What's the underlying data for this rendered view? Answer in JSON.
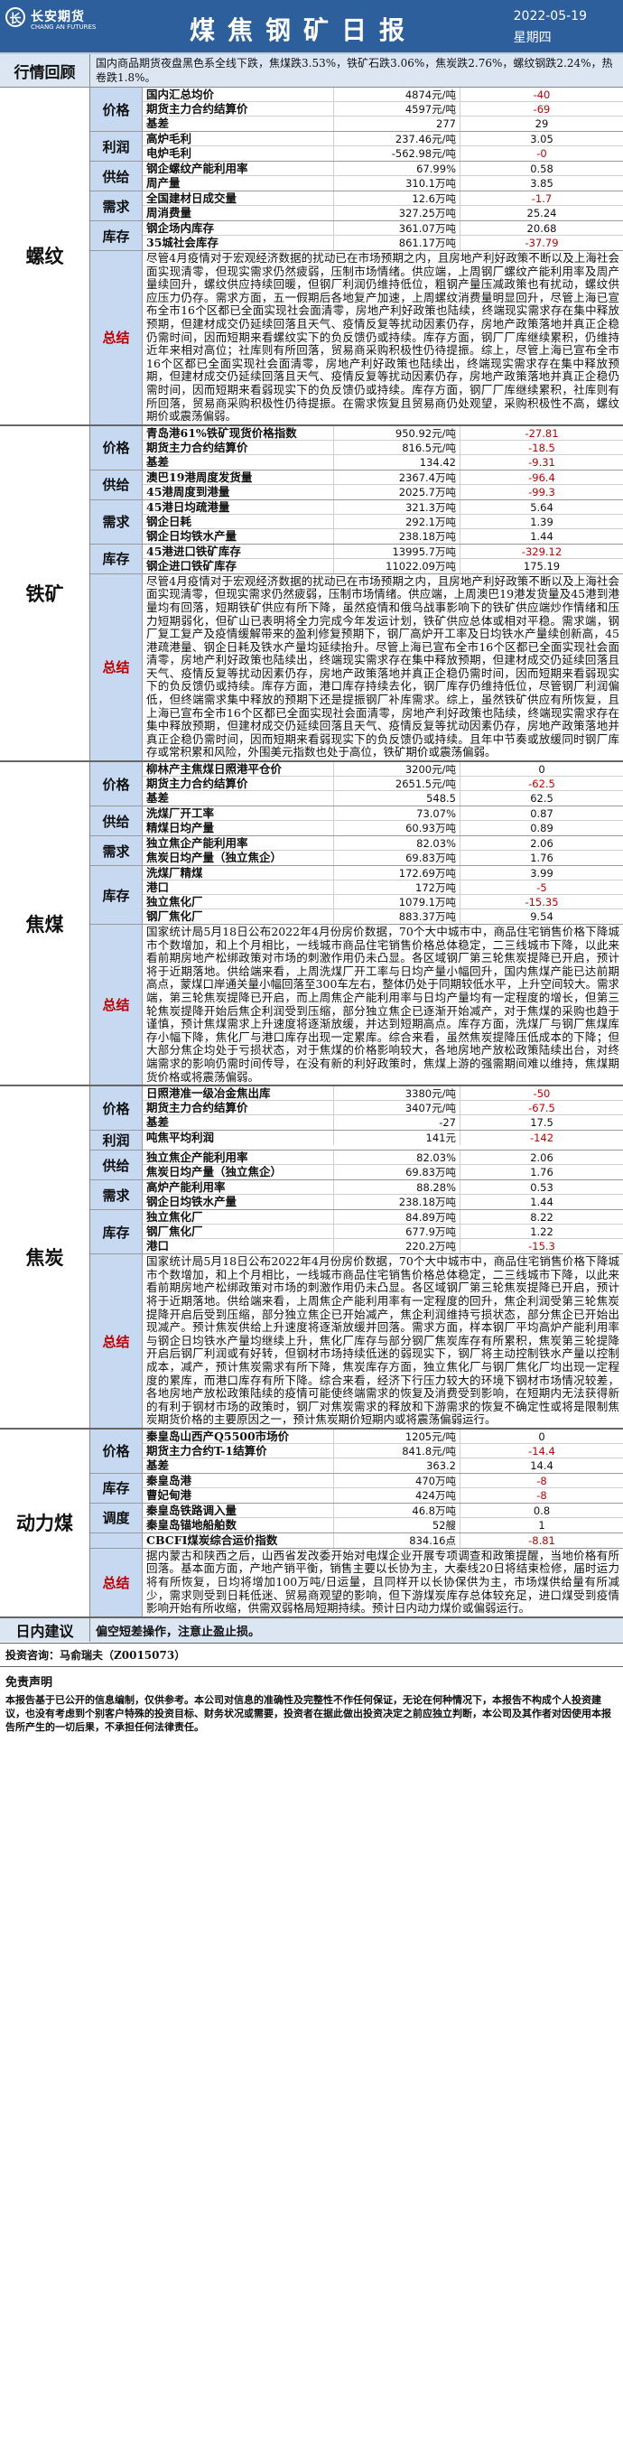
{
  "header": {
    "logo_mark": "长",
    "logo_cn": "长安期货",
    "logo_en": "CHANG AN FUTURES",
    "title": "煤焦钢矿日报",
    "date": "2022-05-19",
    "weekday": "星期四"
  },
  "review": {
    "label": "行情回顾",
    "text": "国内商品期货夜盘黑色系全线下跌，焦煤跌3.53%，铁矿石跌3.06%，焦炭跌2.76%，螺纹钢跌2.24%，热卷跌1.8%。"
  },
  "sections": [
    {
      "name": "螺纹",
      "groups": [
        {
          "cat": "价格",
          "rows": [
            [
              "国内汇总均价",
              "4874元/吨",
              "-40"
            ],
            [
              "期货主力合约结算价",
              "4597元/吨",
              "-69"
            ],
            [
              "基差",
              "277",
              "29"
            ]
          ]
        },
        {
          "cat": "利润",
          "rows": [
            [
              "高炉毛利",
              "237.46元/吨",
              "3.05"
            ],
            [
              "电炉毛利",
              "-562.98元/吨",
              "-0"
            ]
          ]
        },
        {
          "cat": "供给",
          "rows": [
            [
              "钢企螺纹产能利用率",
              "67.99%",
              "0.58"
            ],
            [
              "周产量",
              "310.1万吨",
              "3.85"
            ]
          ]
        },
        {
          "cat": "需求",
          "rows": [
            [
              "全国建材日成交量",
              "12.6万吨",
              "-1.7"
            ],
            [
              "周消费量",
              "327.25万吨",
              "25.24"
            ]
          ]
        },
        {
          "cat": "库存",
          "rows": [
            [
              "钢企场内库存",
              "361.07万吨",
              "20.68"
            ],
            [
              "35城社会库存",
              "861.17万吨",
              "-37.79"
            ]
          ]
        }
      ],
      "summary": "尽管4月疫情对于宏观经济数据的扰动已在市场预期之内，且房地产利好政策不断以及上海社会面实现清零，但现实需求仍然疲弱，压制市场情绪。供应端，上周钢厂螺纹产能利用率及周产量续回升，螺纹供应持续回暖，但钢厂利润仍维持低位，粗钢产量压减政策也有扰动，螺纹供应压力仍存。需求方面，五一假期后各地复产加速，上周螺纹消费量明显回升，尽管上海已宣布全市16个区都已全面实现社会面清零，房地产利好政策也陆续，终端现实需求存在集中释放预期，但建材成交仍延续回落且天气、疫情反复等扰动因素仍存，房地产政策落地并真正企稳仍需时间，因而短期来看螺纹实下的负反馈仍或持续。库存方面，钢厂厂库继续累积，仍维持近年来相对高位；社库则有所回落，贸易商采购积极性仍待提振。综上，尽管上海已宣布全市16个区都已全面实现社会面清零，房地产利好政策也陆续出，终端现实需求存在集中释放预期，但建材成交仍延续回落且天气、疫情反复等扰动因素仍存，房地产政策落地并真正企稳仍需时间，因而短期来看弱现实下的负反馈仍或持续。库存方面，钢厂厂库继续累积，社库则有所回落，贸易商采购积极性仍待提振。在需求恢复且贸易商仍处观望，采购积极性不高，螺纹期价或震荡偏弱。"
    },
    {
      "name": "铁矿",
      "groups": [
        {
          "cat": "价格",
          "rows": [
            [
              "青岛港61%铁矿现货价格指数",
              "950.92元/吨",
              "-27.81"
            ],
            [
              "期货主力合约结算价",
              "816.5元/吨",
              "-18.5"
            ],
            [
              "基差",
              "134.42",
              "-9.31"
            ]
          ]
        },
        {
          "cat": "供给",
          "rows": [
            [
              "澳巴19港周度发货量",
              "2367.4万吨",
              "-96.4"
            ],
            [
              "45港周度到港量",
              "2025.7万吨",
              "-99.3"
            ]
          ]
        },
        {
          "cat": "需求",
          "rows": [
            [
              "45港日均疏港量",
              "321.3万吨",
              "5.64"
            ],
            [
              "钢企日耗",
              "292.1万吨",
              "1.39"
            ],
            [
              "钢企日均铁水产量",
              "238.18万吨",
              "1.44"
            ]
          ]
        },
        {
          "cat": "库存",
          "rows": [
            [
              "45港进口铁矿库存",
              "13995.7万吨",
              "-329.12"
            ],
            [
              "钢企进口铁矿库存",
              "11022.09万吨",
              "175.19"
            ]
          ]
        }
      ],
      "summary": "尽管4月疫情对于宏观经济数据的扰动已在市场预期之内，且房地产利好政策不断以及上海社会面实现清零，但现实需求仍然疲弱，压制市场情绪。供应端，上周澳巴19港发货量及45港到港量均有回落，短期铁矿供应有所下降，虽然疫情和俄乌战事影响下的铁矿供应端炒作情绪和压力短期弱化，但矿山已表明将全力完成今年发运计划，铁矿供应总体或相对平稳。需求端，钢厂复工复产及疫情缓解带来的盈利修复预期下，钢厂高炉开工率及日均铁水产量续创新高，45港疏港量、钢企日耗及铁水产量均延续抬升。尽管上海已宣布全市16个区都已全面实现社会面清零，房地产利好政策也陆续出，终端现实需求存在集中释放预期，但建材成交仍延续回落且天气、疫情反复等扰动因素仍存，房地产政策落地并真正企稳仍需时间，因而短期来看弱现实下的负反馈仍或持续。库存方面，港口库存持续去化，钢厂库存仍维持低位，尽管钢厂利润偏低，但终端需求集中释放的预期下还是提振钢厂补库需求。综上，虽然铁矿供应有所恢复，且上海已宣布全市16个区都已全面实现社会面清零，房地产利好政策也陆续，终端现实需求存在集中释放预期，但建材成交仍延续回落且天气、疫情反复等扰动因素仍存，房地产政策落地并真正企稳仍需时间，因而短期来看弱现实下的负反馈仍或持续。且年中节奏或放缓同时钢厂库存或常积累和风险，外围美元指数也处于高位，铁矿期价或震荡偏弱。"
    },
    {
      "name": "焦煤",
      "groups": [
        {
          "cat": "价格",
          "rows": [
            [
              "柳林产主焦煤日照港平仓价",
              "3200元/吨",
              "0"
            ],
            [
              "期货主力合约结算价",
              "2651.5元/吨",
              "-62.5"
            ],
            [
              "基差",
              "548.5",
              "62.5"
            ]
          ]
        },
        {
          "cat": "供给",
          "rows": [
            [
              "洗煤厂开工率",
              "73.07%",
              "0.87"
            ],
            [
              "精煤日均产量",
              "60.93万吨",
              "0.89"
            ]
          ]
        },
        {
          "cat": "需求",
          "rows": [
            [
              "独立焦企产能利用率",
              "82.03%",
              "2.06"
            ],
            [
              "焦炭日均产量（独立焦企）",
              "69.83万吨",
              "1.76"
            ]
          ]
        },
        {
          "cat": "库存",
          "rows": [
            [
              "洗煤厂精煤",
              "172.69万吨",
              "3.99"
            ],
            [
              "港口",
              "172万吨",
              "-5"
            ],
            [
              "独立焦化厂",
              "1079.1万吨",
              "-15.35"
            ],
            [
              "钢厂焦化厂",
              "883.37万吨",
              "9.54"
            ]
          ]
        }
      ],
      "summary": "国家统计局5月18日公布2022年4月份房价数据，70个大中城市中，商品住宅销售价格下降城市个数增加，和上个月相比，一线城市商品住宅销售价格总体稳定，二三线城市下降，以此来看前期房地产松绑政策对市场的刺激作用仍未凸显。各区域钢厂第三轮焦炭提降已开启，预计将于近期落地。供给端来看，上周洗煤厂开工率与日均产量小幅回升，国内焦煤产能已达前期高点，蒙煤口岸通关量小幅回落至300车左右，整体仍处于同期较低水平，上升空间较大。需求端，第三轮焦炭提降已开启，而上周焦企产能利用率与日均产量均有一定程度的增长，但第三轮焦炭提降开始后焦企利润受到压缩，部分独立焦企已逐渐开始减产，对于焦煤的采购也趋于谨慎，预计焦煤需求上升速度将逐渐放缓，并达到短期高点。库存方面，洗煤厂与钢厂焦煤库存小幅下降，焦化厂与港口库存出现一定累库。综合来看，虽然焦炭提降压低成本的下降；但大部分焦企均处于亏损状态，对于焦煤的价格影响较大，各地房地产放松政策陆续出台，对终端需求的影响仍需时间传导，在没有新的利好政策时，焦煤上游的强需期间难以维持，焦煤期货价格或将震荡偏弱。"
    },
    {
      "name": "焦炭",
      "groups": [
        {
          "cat": "价格",
          "rows": [
            [
              "日照港准一级冶金焦出库",
              "3380元/吨",
              "-50"
            ],
            [
              "期货主力合约结算价",
              "3407元/吨",
              "-67.5"
            ],
            [
              "基差",
              "-27",
              "17.5"
            ]
          ]
        },
        {
          "cat": "利润",
          "rows": [
            [
              "吨焦平均利润",
              "141元",
              "-142"
            ]
          ]
        },
        {
          "cat": "供给",
          "rows": [
            [
              "独立焦企产能利用率",
              "82.03%",
              "2.06"
            ],
            [
              "焦炭日均产量（独立焦企）",
              "69.83万吨",
              "1.76"
            ]
          ]
        },
        {
          "cat": "需求",
          "rows": [
            [
              "高炉产能利用率",
              "88.28%",
              "0.53"
            ],
            [
              "钢企日均铁水产量",
              "238.18万吨",
              "1.44"
            ]
          ]
        },
        {
          "cat": "库存",
          "rows": [
            [
              "独立焦化厂",
              "84.89万吨",
              "8.22"
            ],
            [
              "钢厂焦化厂",
              "677.9万吨",
              "1.22"
            ],
            [
              "港口",
              "220.2万吨",
              "-15.3"
            ]
          ]
        }
      ],
      "summary": "国家统计局5月18日公布2022年4月份房价数据，70个大中城市中，商品住宅销售价格下降城市个数增加，和上个月相比，一线城市商品住宅销售价格总体稳定，二三线城市下降，以此来看前期房地产松绑政策对市场的刺激作用仍未凸显。各区域钢厂第三轮焦炭提降已开启，预计将于近期落地。供给端来看，上周焦企产能利用率有一定程度的回升，焦企利润受第三轮焦炭提降开启后受到压缩，部分独立焦企已开始减产，焦企利润维持亏损状态，部分焦企已开始出现减产。预计焦炭供给上升速度将逐渐放缓并回落。需求方面，样本钢厂平均高炉产能利用率与钢企日均铁水产量均继续上升，焦化厂库存与部分钢厂焦炭库存有所累积，焦炭第三轮提降开启后钢厂利润或有好转，但钢材市场持续低迷的弱现实下，钢厂将主动控制铁水产量以控制成本，减产，预计焦炭需求有所下降，焦炭库存方面，独立焦化厂与钢厂焦化厂均出现一定程度的累库，而港口库存有所下降。综合来看，经济下行压力较大的环境下钢材市场情况较差，各地房地产放松政策陆续的疫情可能使终端需求的恢复及消费受到影响，在短期内无法获得新的有利于钢材市场的政策时，钢厂对焦炭需求的释放和下游需求的恢复不确定性或将是限制焦炭期货价格的主要原因之一，预计焦炭期价短期内或将震荡偏弱运行。"
    },
    {
      "name": "动力煤",
      "groups": [
        {
          "cat": "价格",
          "rows": [
            [
              "秦皇岛山西产Q5500市场价",
              "1205元/吨",
              "0"
            ],
            [
              "期货主力合约T-1结算价",
              "841.8元/吨",
              "-14.4"
            ],
            [
              "基差",
              "363.2",
              "14.4"
            ]
          ]
        },
        {
          "cat": "库存",
          "rows": [
            [
              "秦皇岛港",
              "470万吨",
              "-8"
            ],
            [
              "曹妃甸港",
              "424万吨",
              "-8"
            ]
          ]
        },
        {
          "cat": "调度",
          "rows": [
            [
              "秦皇岛铁路调入量",
              "46.8万吨",
              "0.8"
            ],
            [
              "秦皇岛锚地船舶数",
              "52艘",
              "1"
            ]
          ]
        },
        {
          "cat": "",
          "rows": [
            [
              "CBCFI煤炭综合运价指数",
              "834.16点",
              "-8.81"
            ]
          ]
        }
      ],
      "summary": "据内蒙古和陕西之后，山西省发改委开始对电煤企业开展专项调查和政策提醒，当地价格有所回落。基本面方面，产地产销平衡，销售主要以长协为主，大秦线20日将结束检修，届时运力将有所恢复，日均将增加100万吨/日运量，且同样开以长协保供为主，市场煤供给量有所减少，需求则受到日耗低迷、贸易商观望的影响，但下游煤炭库存总体较充足，进口煤受到疫情影响开始有所收缩，供需双弱格局短期持续。预计日内动力煤价或偏弱运行。"
    }
  ],
  "daily_advice": {
    "label": "日内建议",
    "text": "偏空短差操作，注意止盈止损。"
  },
  "author": "投资咨询：马俞瑞夫（Z0015073）",
  "disclaimer": {
    "title": "免责声明",
    "text": "本报告基于已公开的信息编制，仅供参考。本公司对信息的准确性及完整性不作任何保证，无论在何种情况下，本报告不构成个人投资建议，也没有考虑到个别客户特殊的投资目标、财务状况或需要，投资者在据此做出投资决定之前应独立判断，本公司及其作者对因使用本报告所产生的一切后果，不承担任何法律责任。"
  }
}
